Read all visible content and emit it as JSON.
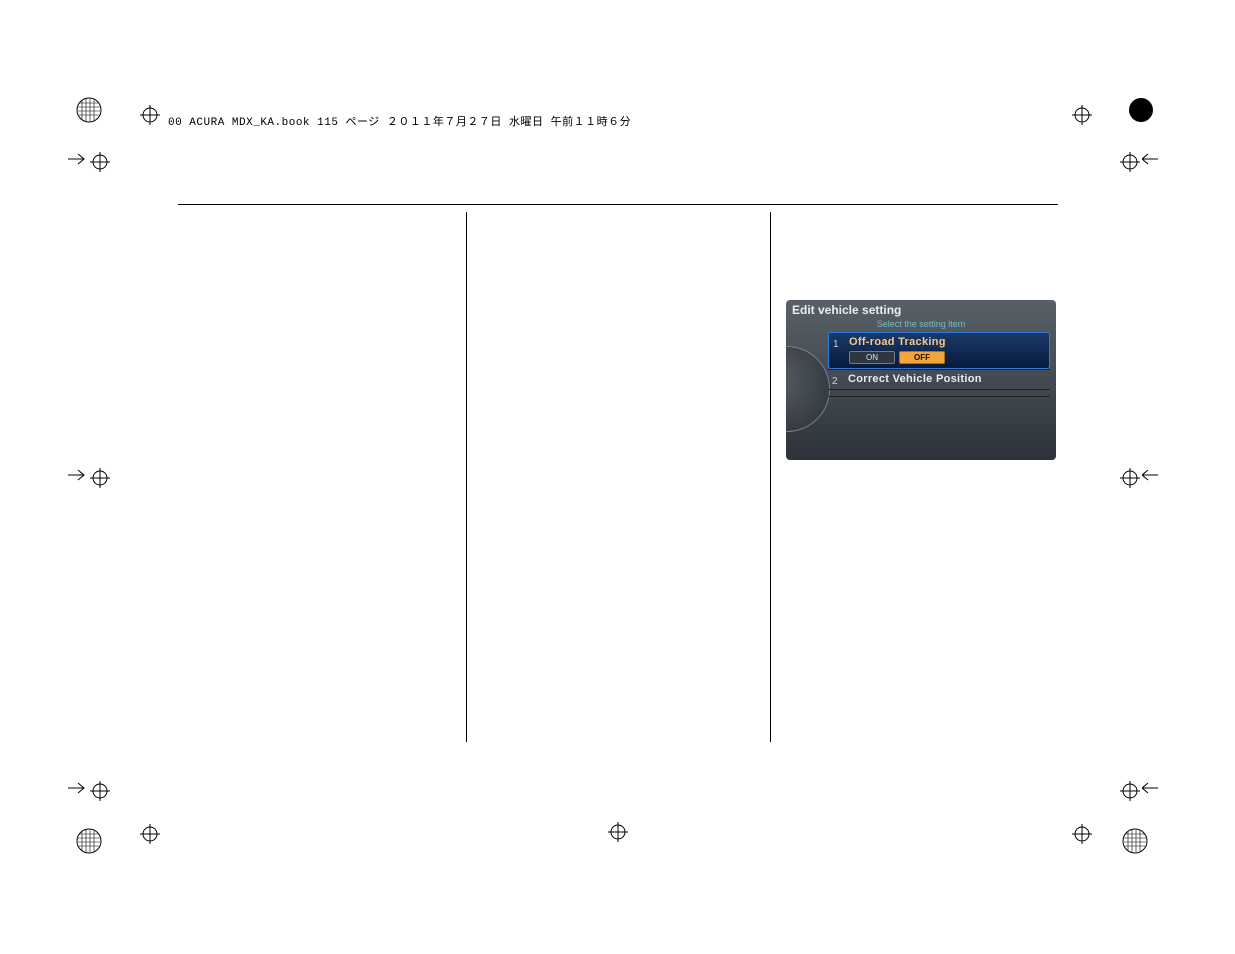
{
  "running_head": "00 ACURA MDX_KA.book  115 ページ  ２０１１年７月２７日  水曜日  午前１１時６分",
  "device": {
    "title": "Edit vehicle setting",
    "subtitle": "Select the setting item",
    "rows": [
      {
        "num": "1",
        "label": "Off-road Tracking",
        "on": "ON",
        "off": "OFF"
      },
      {
        "num": "2",
        "label": "Correct Vehicle Position"
      }
    ]
  }
}
